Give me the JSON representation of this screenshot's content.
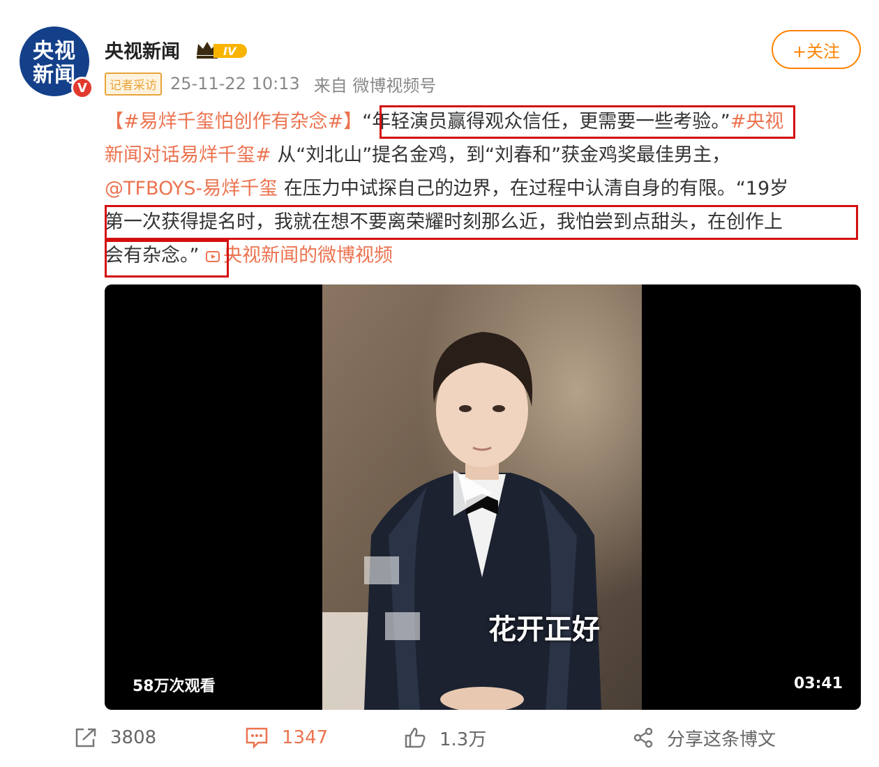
{
  "header": {
    "avatar_line1": "央视",
    "avatar_line2": "新闻",
    "verify_badge": "V",
    "username": "央视新闻",
    "level_badge": "IV",
    "follow_label": "+关注",
    "tag": "记者采访",
    "time": "25-11-22 10:13",
    "source": "来自 微博视频号"
  },
  "post": {
    "line1_topic": "【#易烊千玺怕创作有杂念#】",
    "line1_quote": "“年轻演员赢得观众信任，更需要一些考验。”",
    "line1_hashtag_start": "#央视",
    "line2_hashtag_end": "新闻对话易烊千玺#",
    "line2_text": " 从“刘北山”提名金鸡，到“刘春和”获金鸡奖最佳男主，",
    "line3_mention": "@TFBOYS-易烊千玺",
    "line3_text": " 在压力中试探自己的边界，在过程中认清自身的有限。“19岁",
    "line4_text": "第一次获得提名时，我就在想不要离荣耀时刻那么近，我怕尝到点甜头，在创作上",
    "line5_text": "会有杂念。”",
    "video_link": "央视新闻的微博视频"
  },
  "video": {
    "caption": "花开正好",
    "views": "58万次观看",
    "duration": "03:41"
  },
  "actions": {
    "repost_count": "3808",
    "comment_count": "1347",
    "like_count": "1.3万",
    "share_label": "分享这条博文"
  },
  "colors": {
    "brand_orange": "#ff8200",
    "topic_orange": "#eb7350",
    "highlight_red": "#d40f0f",
    "avatar_blue": "#14408a"
  },
  "icons": [
    "verified-v-icon",
    "crown-level-icon",
    "video-link-icon",
    "play-icon",
    "repost-icon",
    "comment-icon",
    "like-icon",
    "share-icon"
  ]
}
